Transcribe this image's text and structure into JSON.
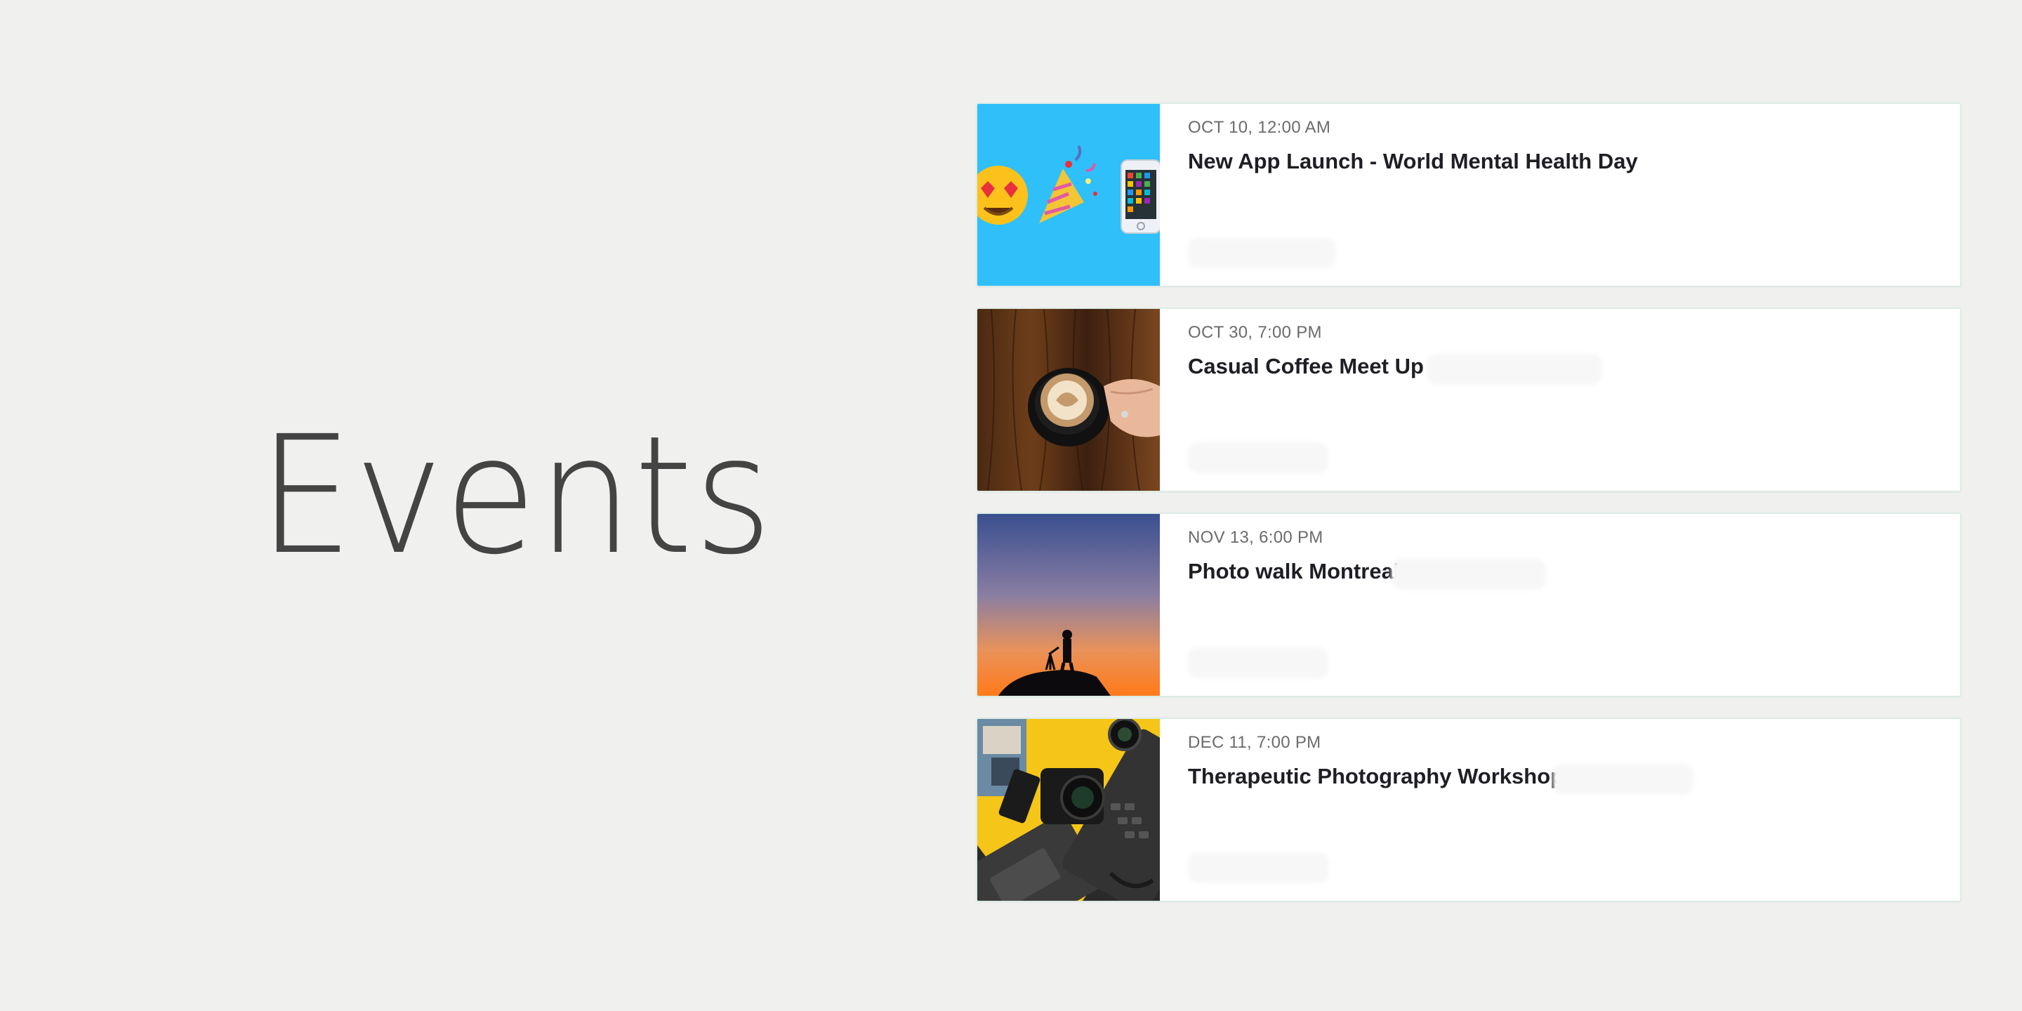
{
  "page": {
    "title": "Events"
  },
  "colors": {
    "background": "#f0f0ef",
    "card_border": "#dcebe4",
    "title": "#1e1e24",
    "date": "#6b6b6b",
    "heading": "#444444"
  },
  "events": [
    {
      "date": "OCT 10, 12:00 AM",
      "title": "New App Launch - World Mental Health Day",
      "image": "emoji-party-phone-image"
    },
    {
      "date": "OCT 30, 7:00 PM",
      "title": "Casual Coffee Meet Up",
      "image": "coffee-latte-image"
    },
    {
      "date": "NOV 13, 6:00 PM",
      "title": "Photo walk Montreal",
      "image": "photographer-sunset-image"
    },
    {
      "date": "DEC 11, 7:00 PM",
      "title": "Therapeutic Photography Workshop",
      "image": "camera-gear-flatlay-image"
    }
  ]
}
